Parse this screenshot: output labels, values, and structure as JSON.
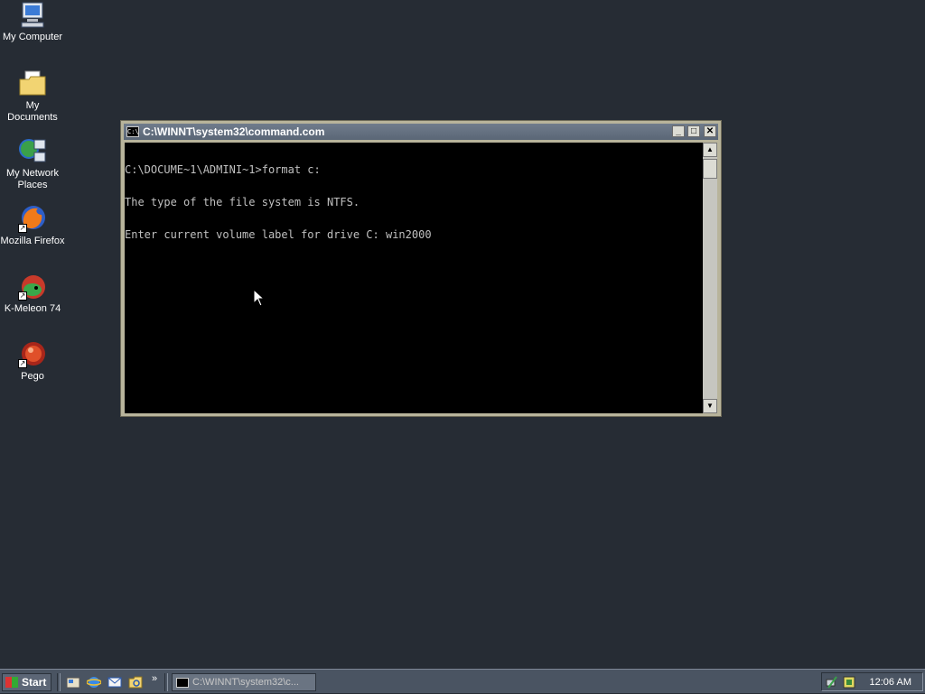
{
  "desktop": {
    "icons": [
      {
        "label": "My Computer",
        "icon": "computer-icon"
      },
      {
        "label": "My Documents",
        "icon": "folder-icon"
      },
      {
        "label": "My Network Places",
        "icon": "network-icon"
      },
      {
        "label": "Mozilla Firefox",
        "icon": "firefox-icon"
      },
      {
        "label": "K-Meleon 74",
        "icon": "kmeleon-icon"
      },
      {
        "label": "Pego",
        "icon": "pego-icon"
      }
    ]
  },
  "console": {
    "title": "C:\\WINNT\\system32\\command.com",
    "icon_text": "C:\\",
    "lines": [
      "C:\\DOCUME~1\\ADMINI~1>format c:",
      "The type of the file system is NTFS.",
      "Enter current volume label for drive C: win2000"
    ],
    "buttons": {
      "minimize": "_",
      "maximize": "□",
      "close": "✕"
    }
  },
  "taskbar": {
    "start_label": "Start",
    "quick_launch": [
      "show-desktop-icon",
      "ie-icon",
      "outlook-icon",
      "explorer-icon"
    ],
    "more": "»",
    "task_label": "C:\\WINNT\\system32\\c...",
    "clock": "12:06 AM"
  }
}
